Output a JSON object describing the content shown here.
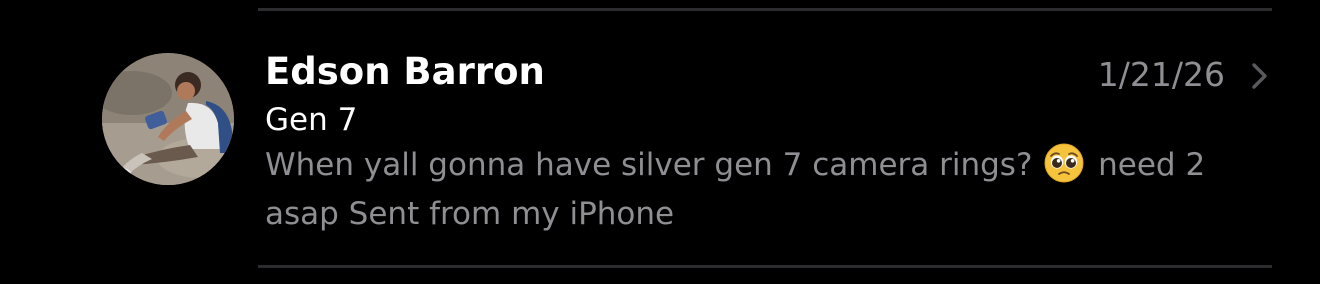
{
  "message": {
    "sender": "Edson Barron",
    "date": "1/21/26",
    "subject": "Gen 7",
    "preview_before_emoji": "When yall gonna have silver gen 7 camera rings?",
    "preview_emoji_icon": "pleading-face-emoji",
    "preview_after_emoji": "need 2 asap Sent from my iPhone"
  },
  "colors": {
    "background": "#000000",
    "primary_text": "#ffffff",
    "secondary_text": "#8e8e93",
    "separator": "#2c2c2e"
  },
  "icons": {
    "disclosure": "chevron-right-icon",
    "avatar": "contact-photo"
  }
}
